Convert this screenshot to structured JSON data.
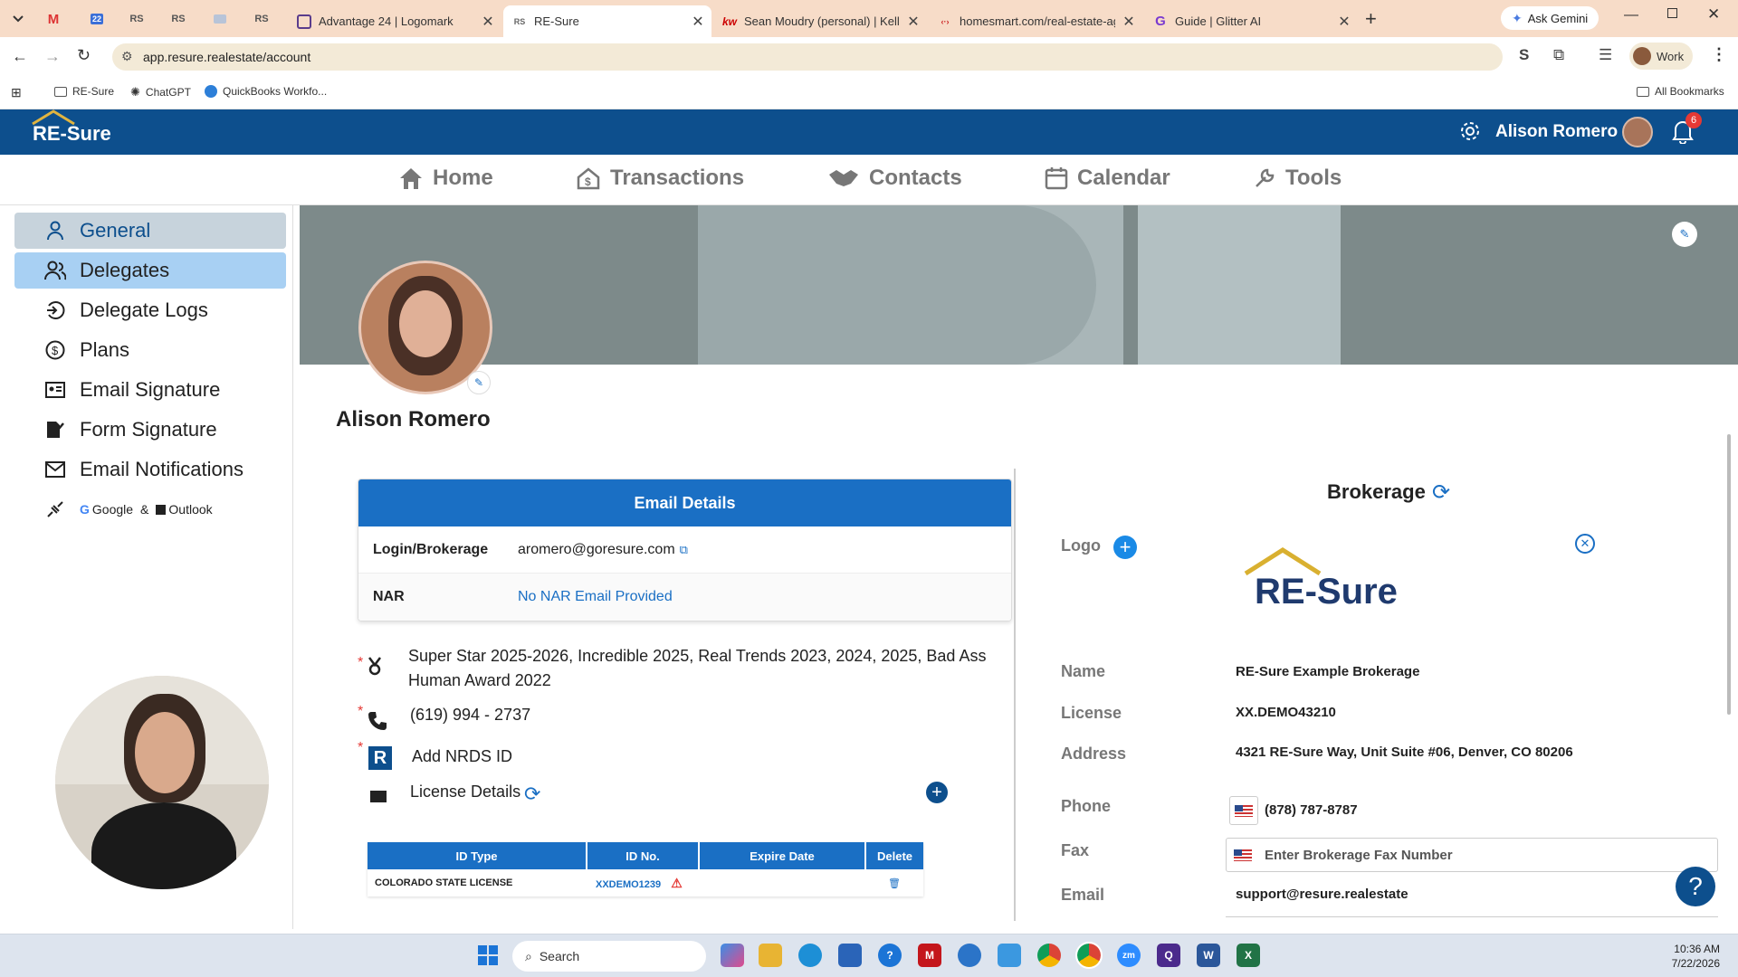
{
  "browser": {
    "pinned_tabs": [
      "M",
      "22",
      "RS",
      "RS",
      "",
      "RS"
    ],
    "tabs": [
      {
        "title": "Advantage 24 | Logomark",
        "icon": "logomark-icon"
      },
      {
        "title": "RE-Sure",
        "icon": "resure-icon",
        "active": true
      },
      {
        "title": "Sean Moudry (personal) | Keller",
        "icon": "kw-icon",
        "fav": "kw"
      },
      {
        "title": "homesmart.com/real-estate-ag",
        "icon": "homesmart-icon"
      },
      {
        "title": "Guide | Glitter AI",
        "icon": "glitter-icon",
        "fav": "G"
      }
    ],
    "ask_gemini": "Ask Gemini",
    "url": "app.resure.realestate/account",
    "profile": "Work",
    "bookmarks": [
      "RE-Sure",
      "ChatGPT",
      "QuickBooks Workfo..."
    ],
    "all_bookmarks": "All Bookmarks"
  },
  "app": {
    "logo": "RE-Sure",
    "user_name": "Alison Romero",
    "notification_count": "6",
    "nav": [
      {
        "label": "Home",
        "icon": "home-icon"
      },
      {
        "label": "Transactions",
        "icon": "transactions-icon"
      },
      {
        "label": "Contacts",
        "icon": "handshake-icon"
      },
      {
        "label": "Calendar",
        "icon": "calendar-icon"
      },
      {
        "label": "Tools",
        "icon": "wrench-icon"
      }
    ]
  },
  "sidebar": {
    "items": [
      {
        "label": "General",
        "icon": "person-icon"
      },
      {
        "label": "Delegates",
        "icon": "delegates-icon"
      },
      {
        "label": "Delegate Logs",
        "icon": "logs-icon"
      },
      {
        "label": "Plans",
        "icon": "dollar-icon"
      },
      {
        "label": "Email Signature",
        "icon": "id-card-icon"
      },
      {
        "label": "Form Signature",
        "icon": "signature-icon"
      },
      {
        "label": "Email Notifications",
        "icon": "envelope-icon"
      }
    ],
    "integrations": {
      "google": "Google",
      "amp": "&",
      "outlook": "Outlook"
    }
  },
  "profile": {
    "name": "Alison Romero",
    "email_details": {
      "title": "Email Details",
      "rows": [
        {
          "label": "Login/Brokerage",
          "value": "aromero@goresure.com"
        },
        {
          "label": "NAR",
          "value": "No NAR Email Provided"
        }
      ]
    },
    "awards": "Super Star 2025-2026, Incredible 2025, Real Trends 2023, 2024, 2025, Bad Ass Human Award 2022",
    "phone": "(619) 994 - 2737",
    "nrds": "Add NRDS ID",
    "license_details": "License Details",
    "license_table": {
      "headers": [
        "ID Type",
        "ID No.",
        "Expire Date",
        "Delete"
      ],
      "rows": [
        {
          "type": "COLORADO STATE LICENSE",
          "id": "XXDEMO1239",
          "expire": ""
        }
      ]
    }
  },
  "brokerage": {
    "title": "Brokerage",
    "logo_label": "Logo",
    "logo_text": "RE-Sure",
    "name_label": "Name",
    "name": "RE-Sure Example Brokerage",
    "license_label": "License",
    "license": "XX.DEMO43210",
    "address_label": "Address",
    "address": "4321 RE-Sure Way, Unit Suite #06, Denver, CO 80206",
    "phone_label": "Phone",
    "phone": "(878) 787-8787",
    "fax_label": "Fax",
    "fax_placeholder": "Enter Brokerage Fax Number",
    "email_label": "Email",
    "email": "support@resure.realestate"
  },
  "taskbar": {
    "search": "Search",
    "time": "10:36 AM",
    "date": "7/22/2026"
  },
  "colors": {
    "brand": "#0d4f8d",
    "accent": "#1a6fc4",
    "sidebar_active": "#a8d0f3",
    "sidebar_general": "#c7d3dc"
  }
}
